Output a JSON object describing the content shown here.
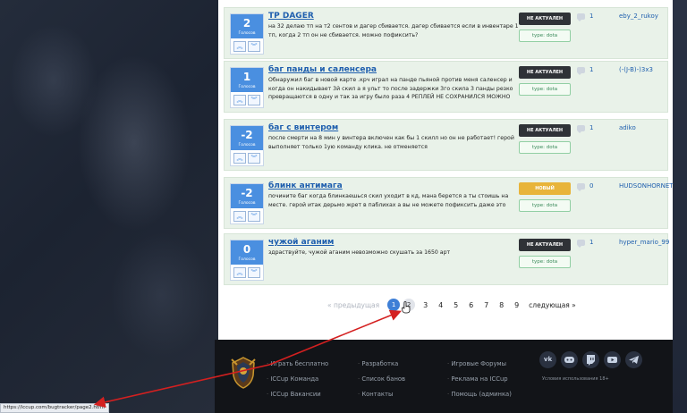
{
  "pagination": {
    "prev_label": "« предыдущая",
    "pages": [
      "1",
      "2",
      "3",
      "4",
      "5",
      "6",
      "7",
      "8",
      "9"
    ],
    "active_page": "1",
    "hovered_page": "2",
    "next_label": "следующая »"
  },
  "posts": [
    {
      "votes": "2",
      "votes_label": "Голосов",
      "title": "TP DAGER",
      "description": "на 32 делаю тп на т2 сентов и дагер сбивается. дагер сбивается если в инвентаре 1 тп, когда 2 тп он не сбивается. можно пофиксить?",
      "status": "НЕ АКТУАЛЕН",
      "type": "type: dota",
      "comments": "1",
      "author": "eby_2_rukoy"
    },
    {
      "votes": "1",
      "votes_label": "Голосов",
      "title": "баг панды и саленсера",
      "description": "Обнаружил баг в новой карте .крч играл на панде пьяной против меня саленсер и когда он накидывает 3й скил а я ульт то после задержки 3го скила 3 панды резко превращаются в одну и так за игру было раза 4 РЕПЛЕЙ НЕ СОХРАНИЛСЯ МОЖНО",
      "status": "НЕ АКТУАЛЕН",
      "type": "type: dota",
      "comments": "1",
      "author": "(-(J-B)-)3x3"
    },
    {
      "votes": "-2",
      "votes_label": "Голосов",
      "title": "баг с винтером",
      "description": "после смерти на 8 мин у винтера включен как бы 1 скилл но он не работает! герой выполняет только 1ую команду клика. не отменяется",
      "status": "НЕ АКТУАЛЕН",
      "type": "type: dota",
      "comments": "1",
      "author": "adiko"
    },
    {
      "votes": "-2",
      "votes_label": "Голосов",
      "title": "блинк антимага",
      "description": "почините баг когда блинкаешься скил уходит в кд, мана берется а ты стоишь на месте. герой итак дерьмо жрет в паблихах а вы не можете пофиксить даже это",
      "status": "НОВЫЙ",
      "status_color": "#e8b43a",
      "type": "type: dota",
      "comments": "0",
      "author": "HUDSONHORNET"
    },
    {
      "votes": "0",
      "votes_label": "Голосов",
      "title": "чужой аганим",
      "description": "здраствуйте, чужой аганим невозможно скушать за 1650 арт",
      "status": "НЕ АКТУАЛЕН",
      "type": "type: dota",
      "comments": "1",
      "author": "hyper_mario_99"
    }
  ],
  "footer": {
    "col1": [
      "Играть бесплатно",
      "ICCup Команда",
      "ICCup Вакансии"
    ],
    "col2": [
      "Разработка",
      "Список банов",
      "Контакты"
    ],
    "col3": [
      "Игровые Форумы",
      "Реклама на ICCup",
      "Помощь (админка)"
    ],
    "social_icons": [
      "vk-icon",
      "discord-icon",
      "twitch-icon",
      "youtube-icon",
      "telegram-icon"
    ],
    "age_notice": "Условия использования 18+"
  },
  "statusbar": {
    "url": "https://iccup.com/bugtracker/page2.html"
  },
  "colors": {
    "accent": "#4a8fe0",
    "link": "#1f5fae",
    "status_dark": "#2f3237",
    "status_new": "#e8b43a",
    "row_bg": "#e9f2e9",
    "annotation_arrow": "#d42020"
  }
}
